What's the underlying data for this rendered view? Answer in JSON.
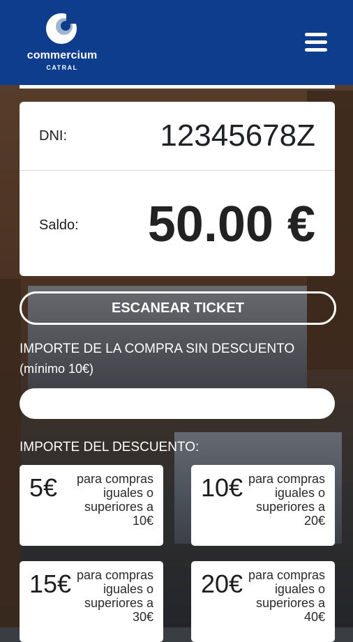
{
  "header": {
    "logo_name": "commercium",
    "logo_sub": "CATRAL",
    "brand_color": "#0d3d8c"
  },
  "account": {
    "dni_label": "DNI:",
    "dni_value": "12345678Z",
    "saldo_label": "Saldo:",
    "saldo_value": "50.00 €"
  },
  "scan_button_label": "ESCANEAR TICKET",
  "purchase": {
    "label": "IMPORTE DE LA COMPRA SIN DESCUENTO",
    "hint": "(mínimo 10€)",
    "value": ""
  },
  "discount": {
    "label": "IMPORTE DEL DESCUENTO:",
    "options": [
      {
        "amount": "5€",
        "desc": "para compras iguales o superiores a 10€"
      },
      {
        "amount": "10€",
        "desc": "para compras iguales o superiores a 20€"
      },
      {
        "amount": "15€",
        "desc": "para compras iguales o superiores a 30€"
      },
      {
        "amount": "20€",
        "desc": "para compras iguales o superiores a 40€"
      }
    ]
  }
}
